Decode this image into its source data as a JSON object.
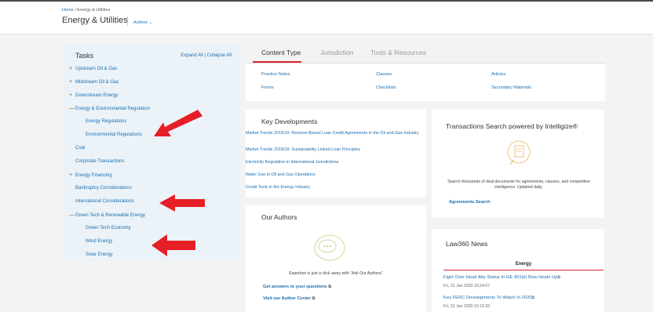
{
  "breadcrumb": {
    "home": "Home",
    "sep": " / ",
    "current": "Energy & Utilities"
  },
  "page": {
    "title": "Energy & Utilities",
    "actions": "Actions"
  },
  "tasks": {
    "title": "Tasks",
    "expand_collapse": "Expand All | Collapse All",
    "items": [
      {
        "sym": "+",
        "label": "Upstream Oil & Gas"
      },
      {
        "sym": "+",
        "label": "Midstream Oil & Gas"
      },
      {
        "sym": "+",
        "label": "Downstream Energy"
      },
      {
        "sym": "—",
        "label": "Energy & Environmental Regulation"
      },
      {
        "sym": "",
        "label": "Energy Regulations"
      },
      {
        "sym": "",
        "label": "Environmental Regulations"
      },
      {
        "sym": "",
        "label": "Coal"
      },
      {
        "sym": "",
        "label": "Corporate Transactions"
      },
      {
        "sym": "+",
        "label": "Energy Financing"
      },
      {
        "sym": "",
        "label": "Bankruptcy Considerations"
      },
      {
        "sym": "",
        "label": "International Considerations"
      },
      {
        "sym": "—",
        "label": "Green Tech & Renewable Energy"
      },
      {
        "sym": "",
        "label": "Green Tech Economy"
      },
      {
        "sym": "",
        "label": "Wind Energy"
      },
      {
        "sym": "",
        "label": "Solar Energy"
      }
    ]
  },
  "tabs": [
    "Content Type",
    "Jurisdiction",
    "Tools & Resources"
  ],
  "content_links": [
    "Practice Notes",
    "Clauses",
    "Articles",
    "Forms",
    "Checklists",
    "Secondary Materials"
  ],
  "key_developments": {
    "title": "Key Developments",
    "links": [
      "Market Trends 2018/19: Reserve-Based Loan Credit Agreements in the Oil and Gas Industry",
      "Market Trends 2018/19: Sustainability Linked Loan Principles",
      "Electricity Regulation in International Jurisdictions",
      "Water Use in Oil and Gas Operations",
      "Credit Tools in the Energy Industry"
    ]
  },
  "transactions": {
    "title": "Transactions Search powered by Intelligize®",
    "description": "Search thousands of deal documents for agreements, clauses, and competitive intelligence. Updated daily.",
    "link": "Agreements Search"
  },
  "authors": {
    "title": "Our Authors",
    "text": "Expertise is just a click away with \"Ask Our Authors\"",
    "link1": "Get answers to your questions",
    "link2": "Visit our Author Center"
  },
  "law360": {
    "title": "Law360 News",
    "section": "Energy",
    "items": [
      {
        "headline": "Fight Over Head Atty Status In GE 401(k) Row Heats Up",
        "date": "Fri, 31 Jan 2020 16:24:07"
      },
      {
        "headline": "Key FERC Developments To Watch In 2020",
        "date": "Fri, 31 Jan 2020 16:10:33"
      }
    ]
  },
  "colors": {
    "accent": "#d9252b",
    "link": "#1a6db0",
    "tasks_bg": "#ebf3f8",
    "icon_outline": "#f0c27a"
  }
}
